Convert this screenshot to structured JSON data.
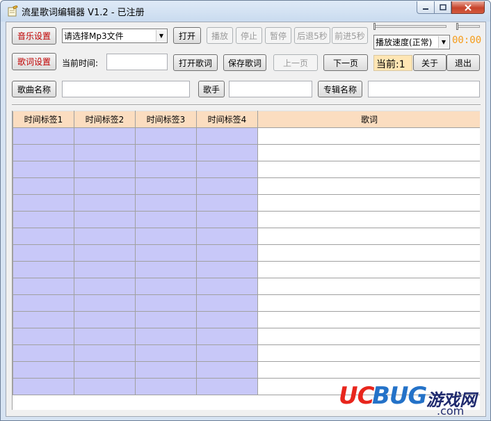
{
  "window": {
    "title": "流星歌词编辑器 V1.2 - 已注册",
    "controls": {
      "minimize": "minimize-icon",
      "maximize": "maximize-icon",
      "close": "close-icon"
    }
  },
  "toolbar": {
    "music_settings": "音乐设置",
    "mp3_select": "请选择Mp3文件",
    "open": "打开",
    "play": "播放",
    "stop": "停止",
    "pause": "暂停",
    "back5": "后退5秒",
    "forward5": "前进5秒",
    "speed_select": "播放速度(正常)",
    "time": "00:00",
    "lyrics_settings": "歌词设置",
    "current_time_label": "当前时间:",
    "current_time_value": "",
    "open_lyrics": "打开歌词",
    "save_lyrics": "保存歌词",
    "prev_page": "上一页",
    "next_page": "下一页",
    "current_page": "当前:1",
    "about": "关于",
    "exit": "退出"
  },
  "song_info": {
    "song_name_label": "歌曲名称",
    "song_name_value": "",
    "singer_label": "歌手",
    "singer_value": "",
    "album_label": "专辑名称",
    "album_value": ""
  },
  "grid": {
    "columns": [
      "时间标签1",
      "时间标签2",
      "时间标签3",
      "时间标签4",
      "歌词"
    ],
    "row_count": 16
  },
  "watermark": {
    "uc": "UC",
    "bug": "BUG",
    "cn": "游戏网",
    "com": ".com"
  },
  "colors": {
    "timestamp_cell": "#c8c8f8",
    "header": "#fbddc0",
    "time_readout": "#f59b18",
    "current_page_bg": "#ffe6b4"
  }
}
